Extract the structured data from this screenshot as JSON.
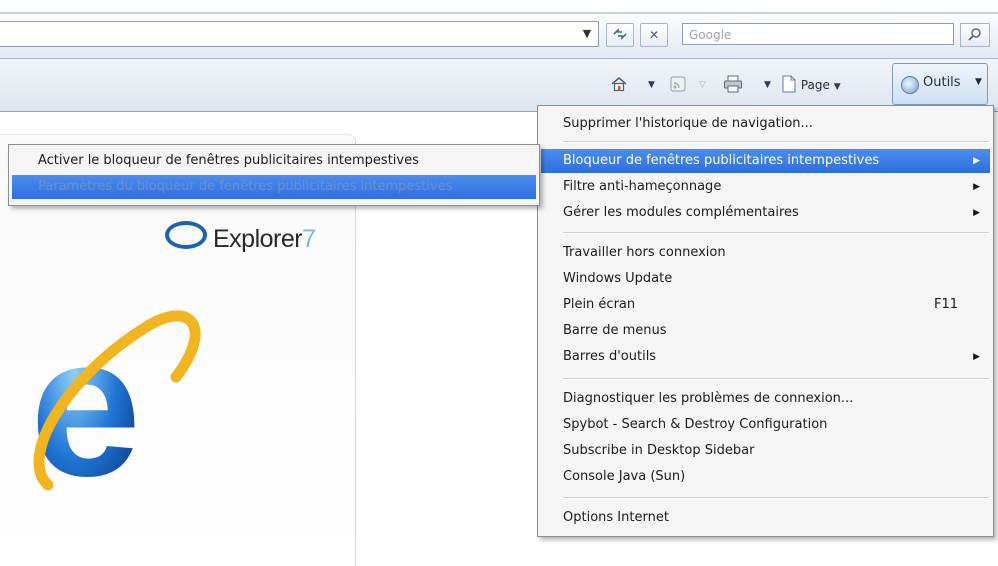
{
  "search": {
    "placeholder": "Google"
  },
  "command_bar": {
    "page_label": "Page",
    "tools_label": "Outils"
  },
  "ie_brand": {
    "name": "Explorer",
    "version": "7"
  },
  "tools_menu": {
    "items": [
      {
        "label": "Supprimer l'historique de navigation..."
      },
      {
        "label": "Bloqueur de fenêtres publicitaires intempestives",
        "submenu": true,
        "highlighted": true
      },
      {
        "label": "Filtre anti-hameçonnage",
        "submenu": true
      },
      {
        "label": "Gérer les modules complémentaires",
        "submenu": true
      },
      {
        "label": "Travailler hors connexion"
      },
      {
        "label": "Windows Update"
      },
      {
        "label": "Plein écran",
        "shortcut": "F11"
      },
      {
        "label": "Barre de menus"
      },
      {
        "label": "Barres d'outils",
        "submenu": true
      },
      {
        "label": "Diagnostiquer les problèmes de connexion..."
      },
      {
        "label": "Spybot - Search & Destroy Configuration"
      },
      {
        "label": "Subscribe in Desktop Sidebar"
      },
      {
        "label": "Console Java (Sun)"
      },
      {
        "label": "Options Internet"
      }
    ]
  },
  "popup_submenu": {
    "items": [
      {
        "label": "Activer le bloqueur de fenêtres publicitaires intempestives"
      },
      {
        "label": "Paramètres du bloqueur de fenêtres publicitaires intempestives",
        "highlighted": true
      }
    ]
  },
  "colors": {
    "highlight": "#2f6edc",
    "menu_bg": "#f5f5f5",
    "toolbar": "#dde5ef"
  }
}
